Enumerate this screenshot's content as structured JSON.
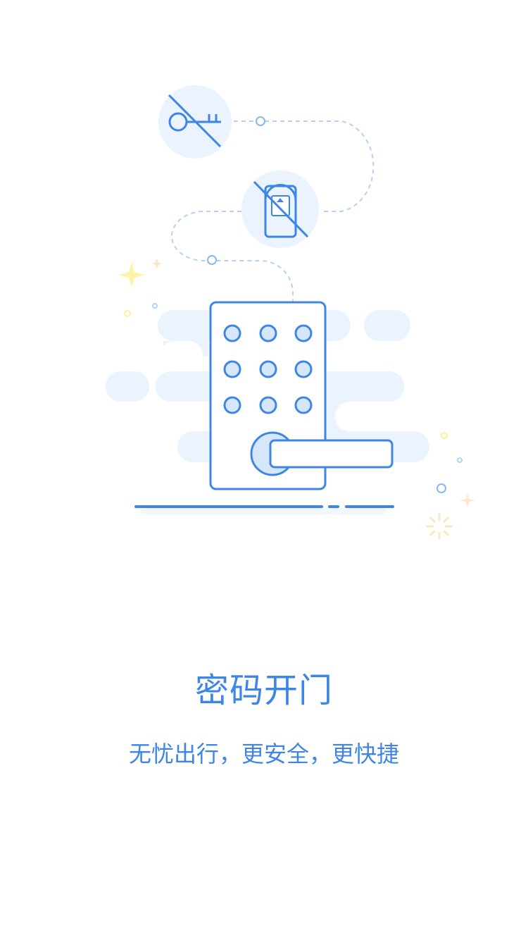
{
  "onboarding": {
    "title": "密码开门",
    "subtitle": "无忧出行，更安全，更快捷"
  },
  "colors": {
    "primary": "#3d86e6",
    "light_fill": "#eaf3fe",
    "dashed_line": "#b5d1f3",
    "sparkle_yellow": "#fdf3a8",
    "sparkle_orange": "#fde6c3"
  },
  "icons": {
    "key_crossed": "key-crossed-icon",
    "card_crossed": "card-crossed-icon",
    "keypad_lock": "keypad-lock-icon"
  }
}
